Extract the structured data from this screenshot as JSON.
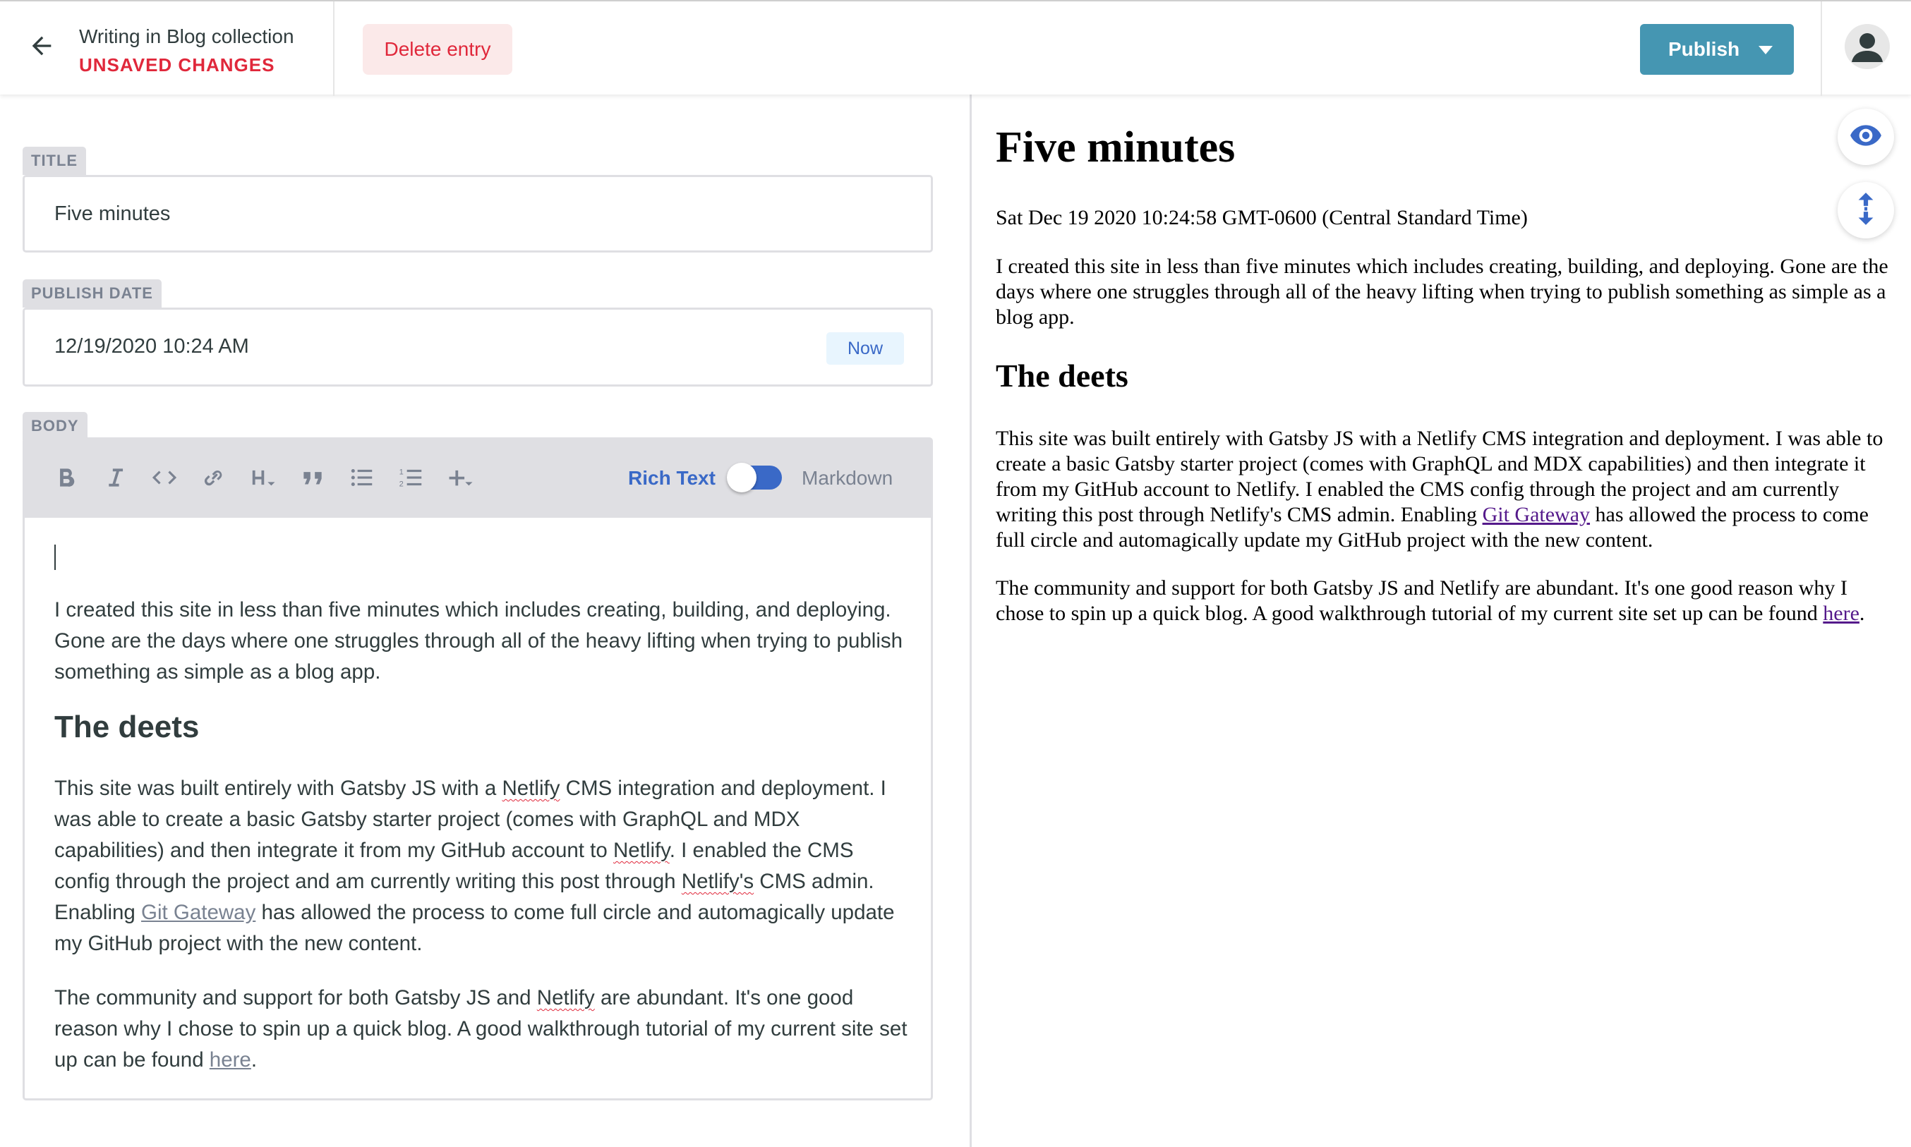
{
  "header": {
    "collection_title": "Writing in Blog collection",
    "status": "UNSAVED CHANGES",
    "delete_label": "Delete entry",
    "publish_label": "Publish",
    "back_icon": "arrow-left-icon",
    "avatar_icon": "user-avatar-icon"
  },
  "fields": {
    "title": {
      "label": "TITLE",
      "value": "Five minutes"
    },
    "publish_date": {
      "label": "PUBLISH DATE",
      "value": "12/19/2020 10:24 AM",
      "now_label": "Now"
    },
    "body": {
      "label": "BODY"
    }
  },
  "toolbar": {
    "buttons": [
      "bold-icon",
      "italic-icon",
      "code-icon",
      "link-icon",
      "heading-icon",
      "quote-icon",
      "bulleted-list-icon",
      "numbered-list-icon",
      "add-component-icon"
    ],
    "rich_text_label": "Rich Text",
    "markdown_label": "Markdown"
  },
  "editor": {
    "p1": "I created this site in less than five minutes which includes creating, building, and deploying. Gone are the days where one struggles through all of the heavy lifting when trying to publish something as simple as a blog app.",
    "h2": "The deets",
    "p2_a": "This site was built entirely with Gatsby JS with a ",
    "p2_b": "Netlify",
    "p2_c": " CMS integration and deployment. I was able to create a basic Gatsby starter project (comes with GraphQL and MDX capabilities) and then integrate it from my GitHub account to ",
    "p2_d": "Netlify",
    "p2_e": ". I enabled the CMS config through the project and am currently writing this post through ",
    "p2_f": "Netlify's",
    "p2_g": " CMS admin. Enabling ",
    "p2_link": "Git Gateway",
    "p2_h": " has allowed the process to come full circle and automagically update my GitHub project with the new content.",
    "p3_a": "The community and support for both Gatsby JS and ",
    "p3_b": "Netlify",
    "p3_c": " are abundant. It's one good reason why I chose to spin up a quick blog. A good walkthrough tutorial of my current site set up can be found ",
    "p3_link": "here",
    "p3_d": "."
  },
  "preview": {
    "title": "Five minutes",
    "date": "Sat Dec 19 2020 10:24:58 GMT-0600 (Central Standard Time)",
    "p1": "I created this site in less than five minutes which includes creating, building, and deploying. Gone are the days where one struggles through all of the heavy lifting when trying to publish something as simple as a blog app.",
    "h2": "The deets",
    "p2_a": "This site was built entirely with Gatsby JS with a Netlify CMS integration and deployment. I was able to create a basic Gatsby starter project (comes with GraphQL and MDX capabilities) and then integrate it from my GitHub account to Netlify. I enabled the CMS config through the project and am currently writing this post through Netlify's CMS admin. Enabling ",
    "p2_link": "Git Gateway",
    "p2_b": " has allowed the process to come full circle and automagically update my GitHub project with the new content.",
    "p3_a": "The community and support for both Gatsby JS and Netlify are abundant. It's one good reason why I chose to spin up a quick blog. A good walkthrough tutorial of my current site set up can be found ",
    "p3_link": "here",
    "p3_b": ".",
    "toggle_preview_icon": "eye-icon",
    "sync_scroll_icon": "sync-scroll-icon"
  },
  "colors": {
    "accent": "#3a69c7",
    "publish": "#4596b2",
    "danger": "#e0283b",
    "label_bg": "#dfdfe3"
  }
}
